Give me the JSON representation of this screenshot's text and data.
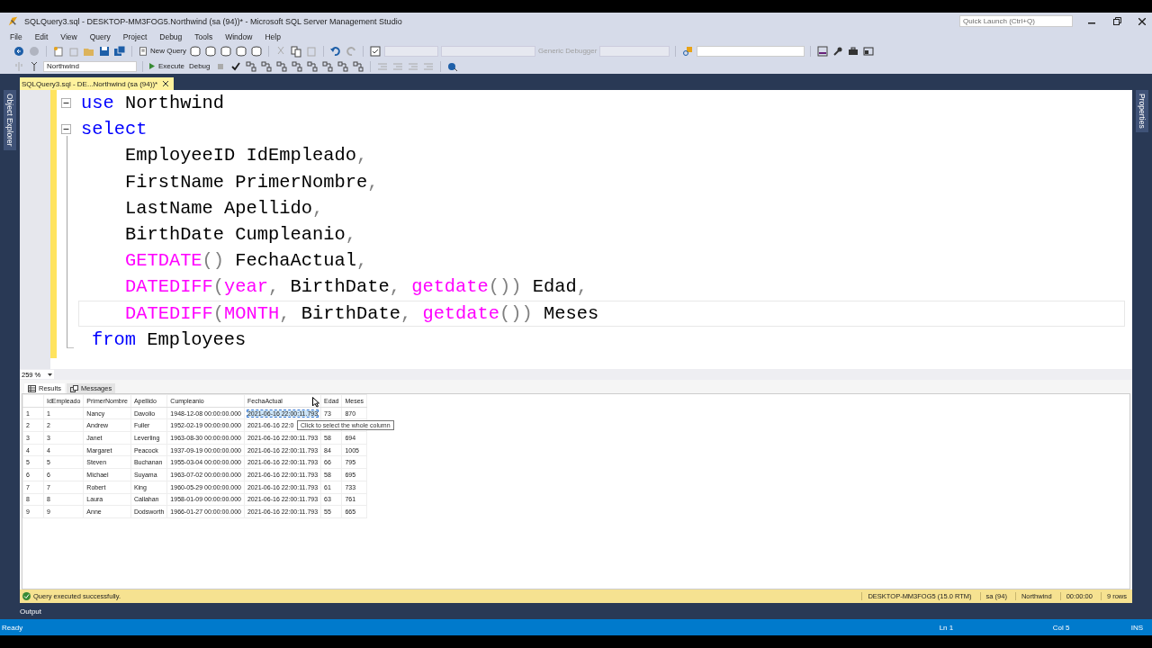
{
  "window": {
    "title": "SQLQuery3.sql - DESKTOP-MM3FOG5.Northwind (sa (94))* - Microsoft SQL Server Management Studio",
    "quick_launch": {
      "placeholder": "Quick Launch (Ctrl+Q)"
    }
  },
  "menu": [
    "File",
    "Edit",
    "View",
    "Query",
    "Project",
    "Debug",
    "Tools",
    "Window",
    "Help"
  ],
  "toolbar": {
    "new_query": "New Query",
    "debugger": "Generic Debugger",
    "database": "Northwind",
    "execute": "Execute",
    "debug": "Debug"
  },
  "side_tabs": {
    "left": "Object Explorer",
    "right": "Properties"
  },
  "document_tab": {
    "title": "SQLQuery3.sql - DE...Northwind (sa (94))*",
    "selected": true
  },
  "editor": {
    "lines": [
      {
        "kind": "block_start",
        "current": false,
        "tokens": [
          {
            "kind": "keyword",
            "text": "use"
          },
          {
            "kind": "plain",
            "text": " Northwind"
          }
        ]
      },
      {
        "kind": "block_start",
        "current": false,
        "tokens": [
          {
            "kind": "keyword",
            "text": "select"
          }
        ]
      },
      {
        "kind": "plain",
        "current": false,
        "tokens": [
          {
            "kind": "plain",
            "text": "    EmployeeID IdEmpleado"
          },
          {
            "kind": "punct",
            "text": ","
          }
        ]
      },
      {
        "kind": "plain",
        "current": false,
        "tokens": [
          {
            "kind": "plain",
            "text": "    FirstName PrimerNombre"
          },
          {
            "kind": "punct",
            "text": ","
          }
        ]
      },
      {
        "kind": "plain",
        "current": false,
        "tokens": [
          {
            "kind": "plain",
            "text": "    LastName Apellido"
          },
          {
            "kind": "punct",
            "text": ","
          }
        ]
      },
      {
        "kind": "plain",
        "current": false,
        "tokens": [
          {
            "kind": "plain",
            "text": "    BirthDate Cumpleanio"
          },
          {
            "kind": "punct",
            "text": ","
          }
        ]
      },
      {
        "kind": "plain",
        "current": false,
        "tokens": [
          {
            "kind": "function",
            "text": "    GETDATE"
          },
          {
            "kind": "punct",
            "text": "()"
          },
          {
            "kind": "plain",
            "text": " FechaActual"
          },
          {
            "kind": "punct",
            "text": ","
          }
        ]
      },
      {
        "kind": "plain",
        "current": false,
        "tokens": [
          {
            "kind": "function",
            "text": "    DATEDIFF"
          },
          {
            "kind": "punct",
            "text": "("
          },
          {
            "kind": "function",
            "text": "year"
          },
          {
            "kind": "punct",
            "text": ","
          },
          {
            "kind": "plain",
            "text": " BirthDate"
          },
          {
            "kind": "punct",
            "text": ","
          },
          {
            "kind": "function",
            "text": " getdate"
          },
          {
            "kind": "punct",
            "text": "())"
          },
          {
            "kind": "plain",
            "text": " Edad"
          },
          {
            "kind": "punct",
            "text": ","
          }
        ]
      },
      {
        "kind": "plain",
        "current": true,
        "tokens": [
          {
            "kind": "function",
            "text": "    DATEDIFF"
          },
          {
            "kind": "punct",
            "text": "("
          },
          {
            "kind": "function",
            "text": "MONTH"
          },
          {
            "kind": "punct",
            "text": ","
          },
          {
            "kind": "plain",
            "text": " BirthDate"
          },
          {
            "kind": "punct",
            "text": ","
          },
          {
            "kind": "function",
            "text": " getdate"
          },
          {
            "kind": "punct",
            "text": "())"
          },
          {
            "kind": "plain",
            "text": " Meses"
          }
        ]
      },
      {
        "kind": "block_end",
        "current": false,
        "tokens": [
          {
            "kind": "keyword",
            "text": "from"
          },
          {
            "kind": "plain",
            "text": " Employees"
          }
        ]
      }
    ],
    "zoom": "259 %"
  },
  "result_tabs": [
    {
      "label": "Results",
      "selected": true
    },
    {
      "label": "Messages",
      "selected": false
    }
  ],
  "grid": {
    "columns": [
      {
        "name": "IdEmpleado",
        "selected": false
      },
      {
        "name": "PrimerNombre",
        "selected": false
      },
      {
        "name": "Apellido",
        "selected": false
      },
      {
        "name": "Cumpleanio",
        "selected": false
      },
      {
        "name": "FechaActual",
        "selected": true
      },
      {
        "name": "Edad",
        "selected": false
      },
      {
        "name": "Meses",
        "selected": false
      }
    ],
    "rows": [
      {
        "number": "1",
        "cells": [
          "1",
          "Nancy",
          "Davolio",
          "1948-12-08 00:00:00.000",
          "2021-06-16 22:00:11.793",
          "73",
          "870"
        ],
        "selected": true
      },
      {
        "number": "2",
        "cells": [
          "2",
          "Andrew",
          "Fuller",
          "1952-02-19 00:00:00.000",
          "2021-06-16 22:0"
        ],
        "selected": false
      },
      {
        "number": "3",
        "cells": [
          "3",
          "Janet",
          "Leverling",
          "1963-08-30 00:00:00.000",
          "2021-06-16 22:00:11.793",
          "58",
          "694"
        ],
        "selected": false
      },
      {
        "number": "4",
        "cells": [
          "4",
          "Margaret",
          "Peacock",
          "1937-09-19 00:00:00.000",
          "2021-06-16 22:00:11.793",
          "84",
          "1005"
        ],
        "selected": false
      },
      {
        "number": "5",
        "cells": [
          "5",
          "Steven",
          "Buchanan",
          "1955-03-04 00:00:00.000",
          "2021-06-16 22:00:11.793",
          "66",
          "795"
        ],
        "selected": false
      },
      {
        "number": "6",
        "cells": [
          "6",
          "Michael",
          "Suyama",
          "1963-07-02 00:00:00.000",
          "2021-06-16 22:00:11.793",
          "58",
          "695"
        ],
        "selected": false
      },
      {
        "number": "7",
        "cells": [
          "7",
          "Robert",
          "King",
          "1960-05-29 00:00:00.000",
          "2021-06-16 22:00:11.793",
          "61",
          "733"
        ],
        "selected": false
      },
      {
        "number": "8",
        "cells": [
          "8",
          "Laura",
          "Callahan",
          "1958-01-09 00:00:00.000",
          "2021-06-16 22:00:11.793",
          "63",
          "761"
        ],
        "selected": false
      },
      {
        "number": "9",
        "cells": [
          "9",
          "Anne",
          "Dodsworth",
          "1966-01-27 00:00:00.000",
          "2021-06-16 22:00:11.793",
          "55",
          "665"
        ],
        "selected": false
      }
    ],
    "tooltip": "Click to select the whole column"
  },
  "query_status": {
    "message": "Query executed successfully.",
    "segments": [
      "DESKTOP-MM3FOG5 (15.0 RTM)",
      "sa (94)",
      "Northwind",
      "00:00:00",
      "9 rows"
    ]
  },
  "output_tab": "Output",
  "status_bar": {
    "state": "Ready",
    "line": "Ln 1",
    "column": "Col 5",
    "mode": "INS"
  }
}
